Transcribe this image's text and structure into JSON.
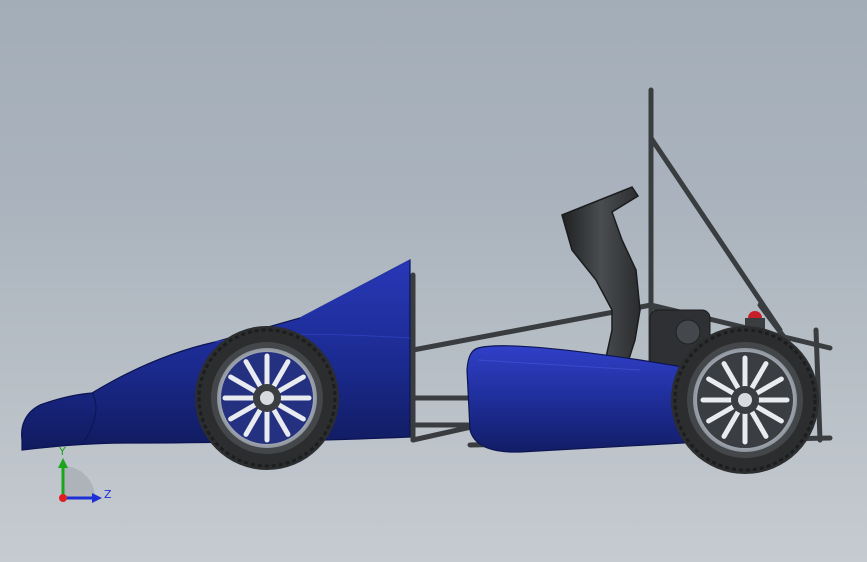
{
  "viewport": {
    "background_top": "#a3adb8",
    "background_bottom": "#c6cbd1"
  },
  "model": {
    "body_color": "#1b2a8f",
    "frame_color": "#3a3d40",
    "tire_color": "#2b2d2f",
    "rim_color": "#d9dde2",
    "seat_color": "#2f3133"
  },
  "triad": {
    "y_label": "Y",
    "z_label": "Z",
    "x_axis_color": "#e02020",
    "y_axis_color": "#1aa51a",
    "z_axis_color": "#1f2fd6"
  }
}
